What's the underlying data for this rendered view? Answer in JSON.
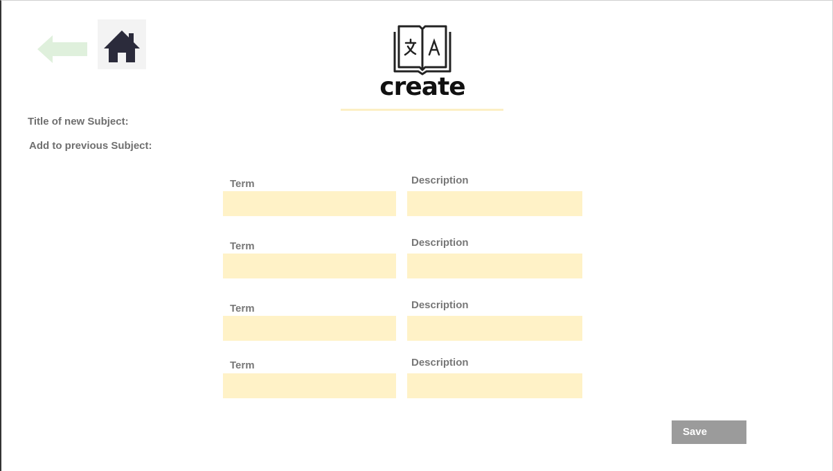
{
  "header": {
    "back_icon": "arrow-left-icon",
    "home_icon": "home-icon",
    "logo_icon": "book-translate-icon",
    "logo_text": "create"
  },
  "form": {
    "title_label": "Title of new Subject:",
    "previous_label": "Add to previous Subject:",
    "rows": [
      {
        "term_label": "Term",
        "description_label": "Description",
        "term_value": "",
        "description_value": ""
      },
      {
        "term_label": "Term",
        "description_label": "Description",
        "term_value": "",
        "description_value": ""
      },
      {
        "term_label": "Term",
        "description_label": "Description",
        "term_value": "",
        "description_value": ""
      },
      {
        "term_label": "Term",
        "description_label": "Description",
        "term_value": "",
        "description_value": ""
      }
    ],
    "save_label": "Save"
  },
  "colors": {
    "input_bg": "#fff2c7",
    "back_arrow": "#dff0dc",
    "home_icon": "#2b2b3b",
    "save_bg": "#9b9b9b",
    "label_text": "#6f6f6f"
  }
}
